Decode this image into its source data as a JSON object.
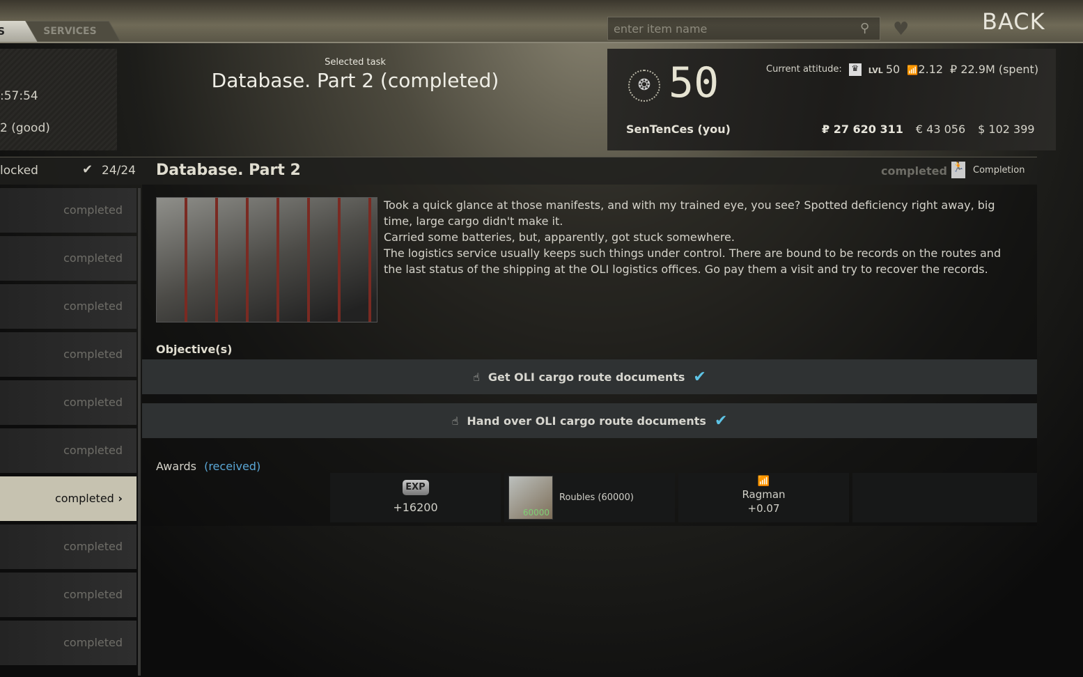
{
  "tabs": [
    {
      "label": "S",
      "active": true
    },
    {
      "label": "SERVICES",
      "active": false
    }
  ],
  "search": {
    "placeholder": "enter item name"
  },
  "back_label": "BACK",
  "trader_info": {
    "timer": ":57:54",
    "standing": "2 (good)"
  },
  "selected_task": {
    "label": "Selected task",
    "title": "Database. Part 2 (completed)"
  },
  "player": {
    "level": "50",
    "name": "SenTenCes (you)",
    "attitude_label": "Current attitude:",
    "lvl_prefix": "LVL",
    "trader_level": "50",
    "reputation": "2.12",
    "spent": "₽ 22.9M (spent)",
    "roubles": "₽ 27 620 311",
    "euros": "€ 43 056",
    "dollars": "$ 102 399"
  },
  "list_header": {
    "filter": "locked",
    "count": "24/24"
  },
  "task_list": [
    "completed",
    "completed",
    "completed",
    "completed",
    "completed",
    "completed",
    "completed",
    "completed",
    "completed",
    "completed"
  ],
  "selected_index": 6,
  "task": {
    "title": "Database. Part 2",
    "status": "completed",
    "type": "Completion",
    "description": "Took a quick glance at those manifests, and with my trained eye, you see? Spotted deficiency right away, big time, large cargo didn't make it.\n Carried some batteries, but, apparently, got stuck somewhere.\n The logistics service usually keeps such things under control. There are bound to be records on the routes and the last status of the shipping at the OLI logistics offices. Go pay them a visit and try to recover the records.",
    "objectives_label": "Objective(s)",
    "objectives": [
      {
        "text": "Get OLI cargo route documents",
        "done": true
      },
      {
        "text": "Hand over OLI cargo route documents",
        "done": true
      }
    ],
    "awards_label": "Awards",
    "awards_status": "(received)",
    "awards": {
      "exp_icon": "EXP",
      "exp": "+16200",
      "item_name": "Roubles (60000)",
      "item_count": "60000",
      "trader": "Ragman",
      "trader_rep": "+0.07"
    }
  },
  "colors": {
    "accent_check": "#5ec4e6",
    "selected_item": "#c6c2b0",
    "received": "#5aa7d6"
  }
}
